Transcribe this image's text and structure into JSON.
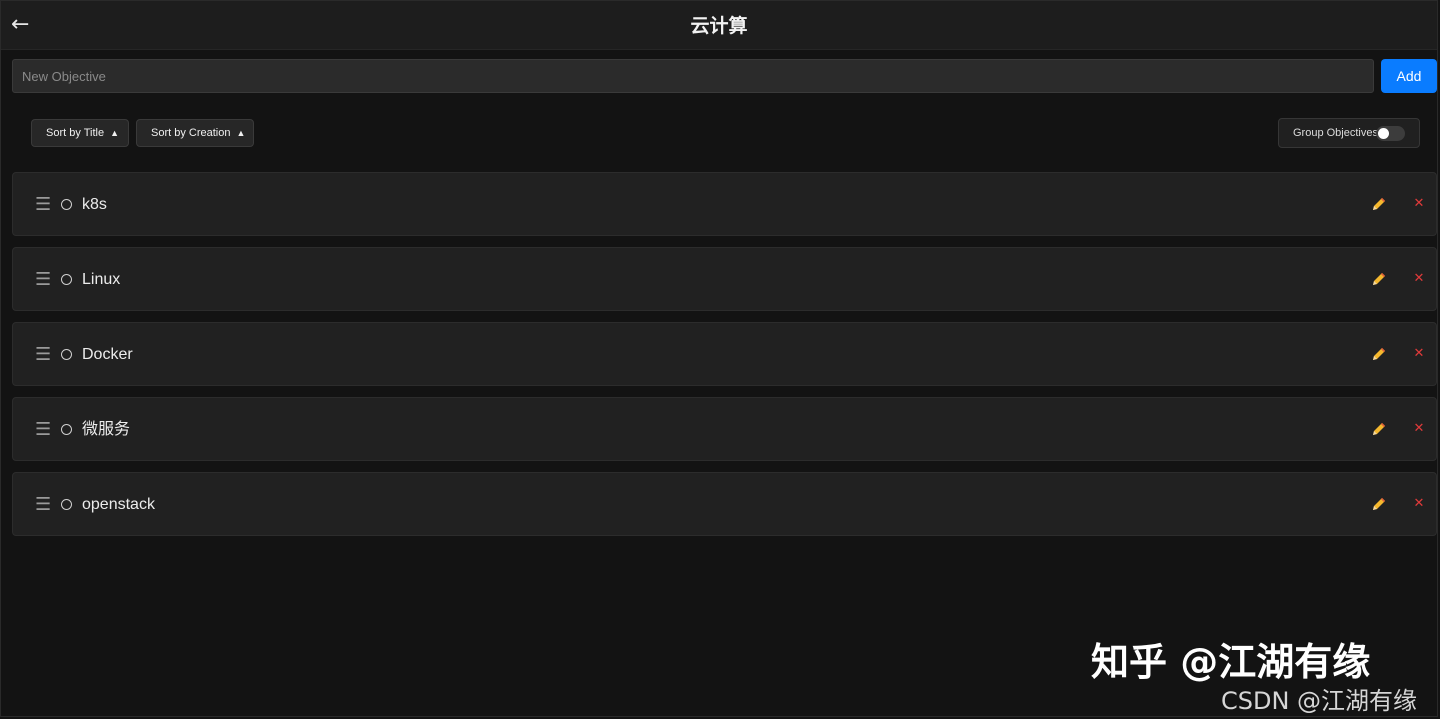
{
  "header": {
    "back_icon": "arrow-left-icon",
    "back_glyph": "←",
    "title": "云计算"
  },
  "new_objective": {
    "placeholder": "New Objective",
    "value": "",
    "add_label": "Add",
    "add_color": "#0a7cff"
  },
  "toolbar": {
    "sort_title_label": "Sort by Title",
    "sort_creation_label": "Sort by Creation",
    "sort_arrow": "▲",
    "group_label": "Group Objectives",
    "group_enabled": false
  },
  "objectives": [
    {
      "title": "k8s"
    },
    {
      "title": "Linux"
    },
    {
      "title": "Docker"
    },
    {
      "title": "微服务"
    },
    {
      "title": "openstack"
    }
  ],
  "icons": {
    "drag": "☰",
    "delete": "✕",
    "delete_color": "#e03a3a",
    "edit_color": "#f5b82e"
  },
  "watermark": {
    "main": "知乎 @江湖有缘",
    "sub": "CSDN @江湖有缘"
  }
}
